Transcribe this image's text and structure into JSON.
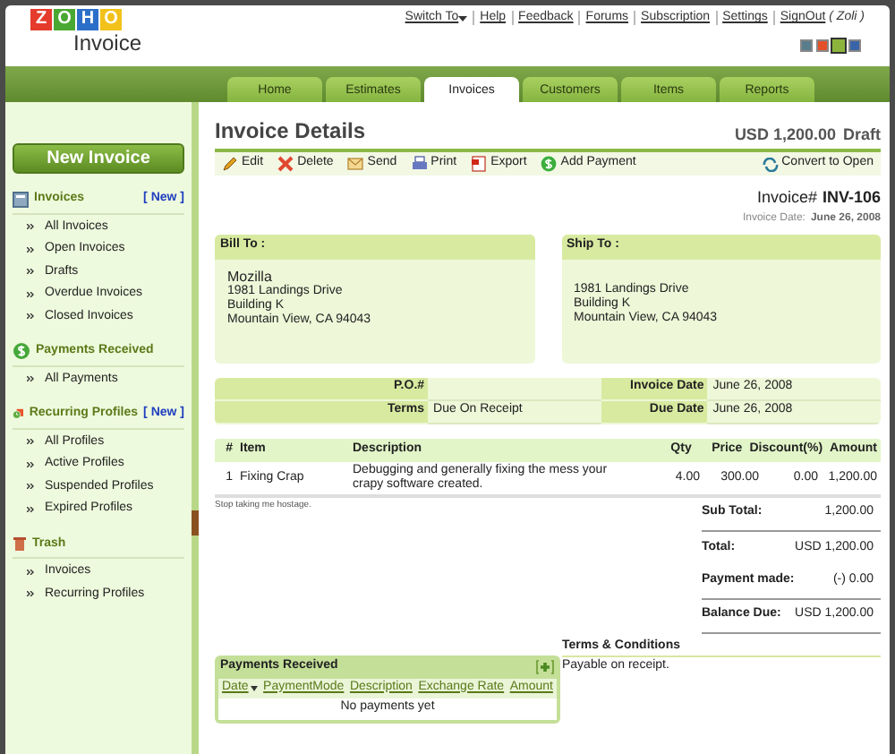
{
  "logo": {
    "letters": [
      "Z",
      "O",
      "H",
      "O"
    ],
    "product": "Invoice"
  },
  "top_links": [
    {
      "label": "Switch To",
      "kind": "dropdown"
    },
    {
      "label": "Help",
      "kind": "link"
    },
    {
      "label": "Feedback",
      "kind": "link"
    },
    {
      "label": "Forums",
      "kind": "link"
    },
    {
      "label": "Subscription",
      "kind": "link"
    },
    {
      "label": "Settings",
      "kind": "link"
    },
    {
      "label": "SignOut",
      "kind": "link"
    }
  ],
  "user": "( Zoli )",
  "themes": [
    {
      "color": "#5a7d8c",
      "selected": false
    },
    {
      "color": "#e4502a",
      "selected": false
    },
    {
      "color": "#8cb43c",
      "selected": true
    },
    {
      "color": "#3a64a8",
      "selected": false
    }
  ],
  "tabs": [
    {
      "label": "Home",
      "selected": false
    },
    {
      "label": "Estimates",
      "selected": false
    },
    {
      "label": "Invoices",
      "selected": true
    },
    {
      "label": "Customers",
      "selected": false
    },
    {
      "label": "Items",
      "selected": false
    },
    {
      "label": "Reports",
      "selected": false
    }
  ],
  "sidebar": {
    "new_button": "New Invoice",
    "sections": [
      {
        "title": "Invoices",
        "new_link": "[ New ]",
        "items": [
          "All Invoices",
          "Open Invoices",
          "Drafts",
          "Overdue Invoices",
          "Closed Invoices"
        ]
      },
      {
        "title": "Payments Received",
        "items": [
          "All Payments"
        ]
      },
      {
        "title": "Recurring Profiles",
        "new_link": "[ New ]",
        "items": [
          "All Profiles",
          "Active Profiles",
          "Suspended Profiles",
          "Expired Profiles"
        ]
      },
      {
        "title": "Trash",
        "items": [
          "Invoices",
          "Recurring Profiles"
        ]
      }
    ]
  },
  "invoice": {
    "title": "Invoice Details",
    "amount": "USD 1,200.00",
    "status": "Draft",
    "actions": [
      "Edit",
      "Delete",
      "Send",
      "Print",
      "Export",
      "Add Payment"
    ],
    "convert": "Convert to Open",
    "number_label": "Invoice#",
    "number": "INV-106",
    "date_label": "Invoice Date:",
    "date": "June 26, 2008",
    "bill_to": {
      "title": "Bill To :",
      "name": "Mozilla",
      "lines": [
        "1981 Landings Drive",
        "Building K",
        "Mountain View, CA 94043"
      ]
    },
    "ship_to": {
      "title": "Ship To :",
      "lines": [
        "1981 Landings Drive",
        "Building K",
        "Mountain View, CA 94043"
      ]
    },
    "meta": [
      {
        "label": "P.O.#"
      },
      {
        "label": "Invoice Date",
        "value": "June 26, 2008"
      },
      {
        "label": "Terms",
        "value": "Due On Receipt"
      },
      {
        "label": "Due Date",
        "value": "June 26, 2008"
      }
    ],
    "columns": [
      "#",
      "Item",
      "Description",
      "Qty",
      "Price",
      "Discount(%)",
      "Amount"
    ],
    "rows": [
      [
        "1",
        "Fixing Crap",
        "Debugging and generally fixing the mess your crapy software created.",
        "4.00",
        "300.00",
        "0.00",
        "1,200.00"
      ]
    ],
    "note": "Stop taking me hostage.",
    "totals": [
      {
        "label": "Sub Total:",
        "value": "1,200.00"
      },
      {
        "label": "Total:",
        "value": "USD 1,200.00"
      },
      {
        "label": "Payment made:",
        "value": "(-) 0.00"
      },
      {
        "label": "Balance Due:",
        "value": "USD 1,200.00"
      }
    ],
    "payments": {
      "title": "Payments Received",
      "columns": [
        "Date",
        "PaymentMode",
        "Description",
        "Exchange Rate",
        "Amount"
      ],
      "empty": "No payments yet"
    },
    "terms": {
      "title": "Terms & Conditions",
      "text": "Payable on receipt."
    }
  }
}
